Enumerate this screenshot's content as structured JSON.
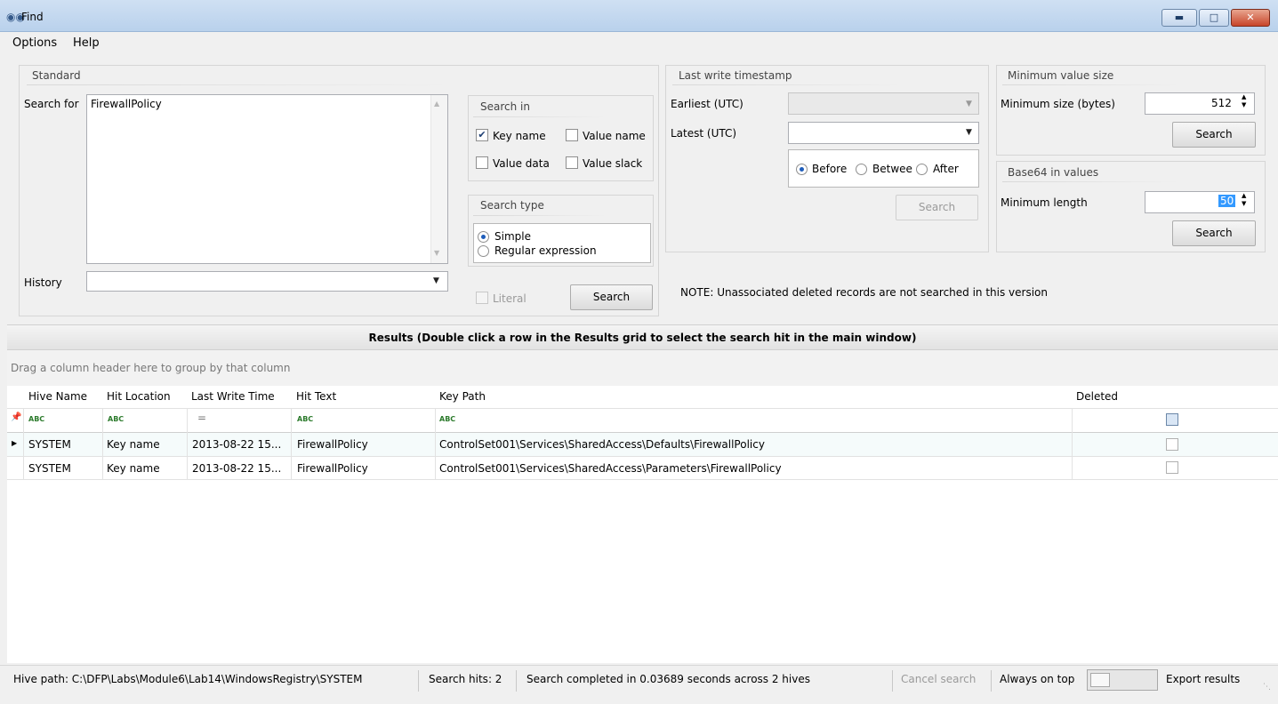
{
  "window": {
    "title": "Find"
  },
  "menu": [
    "Options",
    "Help"
  ],
  "standard": {
    "title": "Standard",
    "search_for_label": "Search for",
    "search_for_value": "FirewallPolicy",
    "history_label": "History",
    "history_value": "",
    "search_in": {
      "title": "Search in",
      "key_name": {
        "label": "Key name",
        "checked": true
      },
      "value_name": {
        "label": "Value name",
        "checked": false
      },
      "value_data": {
        "label": "Value data",
        "checked": false
      },
      "value_slack": {
        "label": "Value slack",
        "checked": false
      }
    },
    "search_type": {
      "title": "Search type",
      "options": [
        "Simple",
        "Regular expression"
      ],
      "selected": "Simple"
    },
    "literal_label": "Literal",
    "search_button": "Search"
  },
  "timestamp": {
    "title": "Last write timestamp",
    "earliest_label": "Earliest (UTC)",
    "latest_label": "Latest (UTC)",
    "earliest_value": "",
    "latest_value": "",
    "modes": [
      "Before",
      "Betwee",
      "After"
    ],
    "selected_mode": "Before",
    "search_button": "Search"
  },
  "min_value_size": {
    "title": "Minimum value size",
    "label": "Minimum size (bytes)",
    "value": "512",
    "search_button": "Search"
  },
  "base64": {
    "title": "Base64 in values",
    "label": "Minimum length",
    "value": "50",
    "search_button": "Search"
  },
  "note": "NOTE: Unassociated deleted records are not searched in this version",
  "results": {
    "header": "Results (Double click a row in the Results grid to select the search hit in the main window)",
    "group_panel_text": "Drag a column header here to group by that column",
    "columns": [
      "Hive Name",
      "Hit Location",
      "Last Write Time",
      "Hit Text",
      "Key Path",
      "Deleted"
    ],
    "rows": [
      {
        "hive": "SYSTEM",
        "location": "Key name",
        "time": "2013-08-22 15...",
        "hit": "FirewallPolicy",
        "path": "ControlSet001\\Services\\SharedAccess\\Defaults\\FirewallPolicy",
        "deleted": false
      },
      {
        "hive": "SYSTEM",
        "location": "Key name",
        "time": "2013-08-22 15...",
        "hit": "FirewallPolicy",
        "path": "ControlSet001\\Services\\SharedAccess\\Parameters\\FirewallPolicy",
        "deleted": false
      }
    ]
  },
  "status": {
    "hive_path": "Hive path: C:\\DFP\\Labs\\Module6\\Lab14\\WindowsRegistry\\SYSTEM",
    "search_hits": "Search hits: 2",
    "completed": "Search completed in 0.03689 seconds across 2 hives",
    "cancel": "Cancel search",
    "always_on_top": "Always on top",
    "export": "Export results"
  },
  "colors": {
    "titlebar": "#b9d1ec",
    "close_button": "#c8452a",
    "selection": "#3399ff"
  }
}
